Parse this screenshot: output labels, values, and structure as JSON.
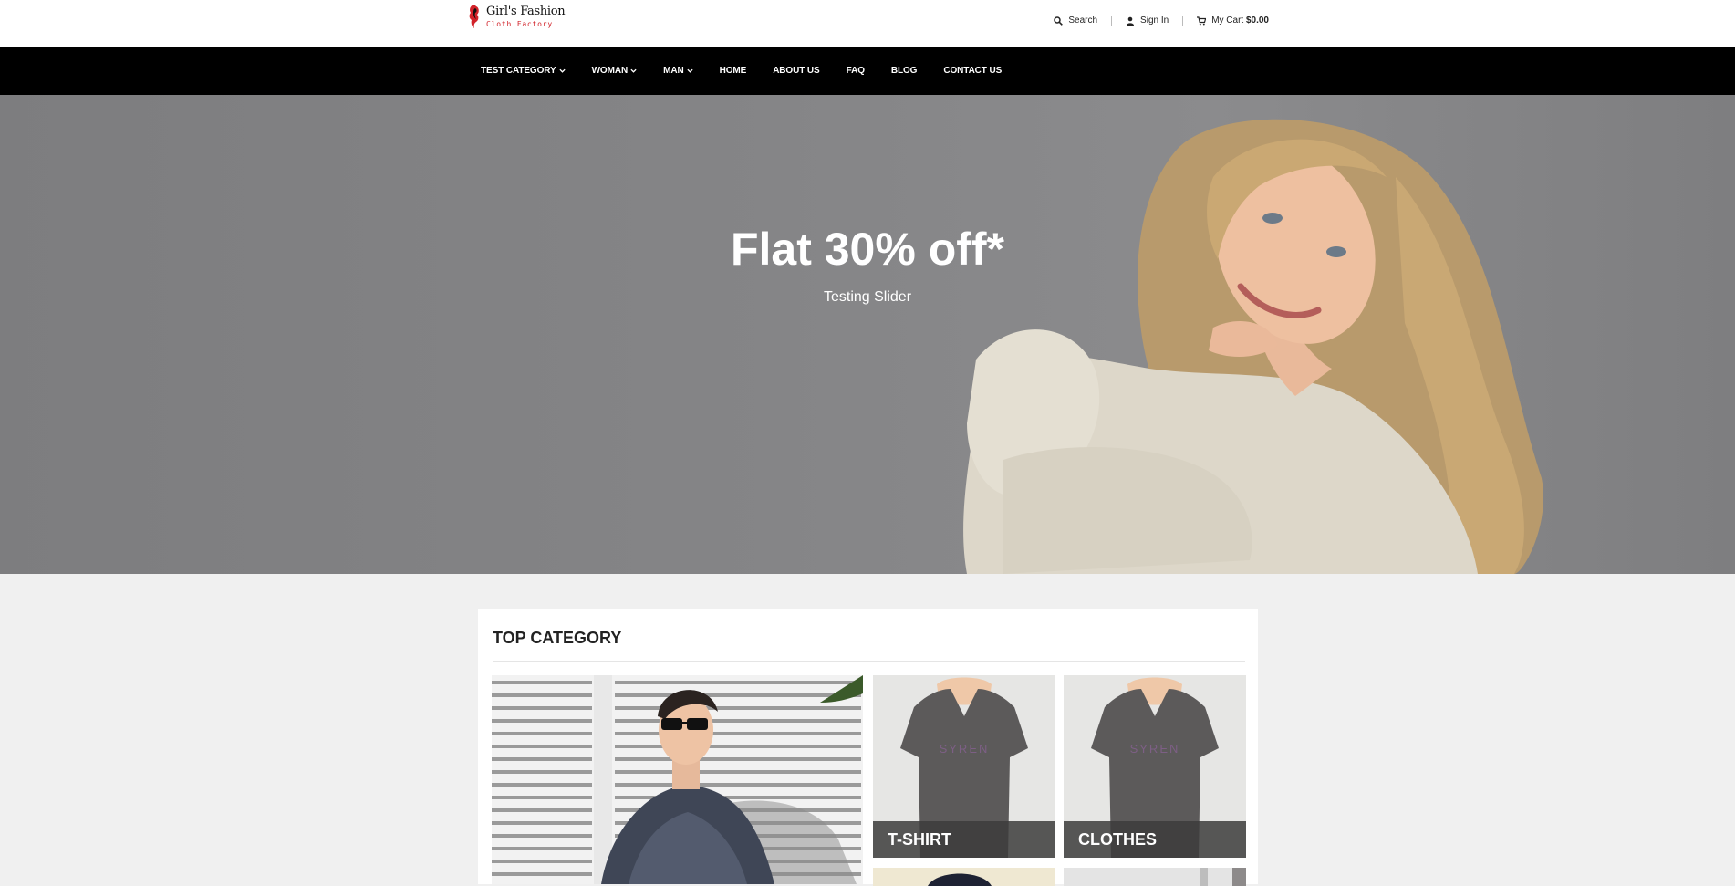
{
  "header": {
    "logo_title": "Girl's Fashion",
    "logo_subtitle": "Cloth Factory",
    "search_label": "Search",
    "signin_label": "Sign In",
    "cart_label": "My Cart",
    "cart_amount": "$0.00"
  },
  "nav": {
    "items": [
      {
        "label": "TEST CATEGORY",
        "dropdown": true
      },
      {
        "label": "WOMAN",
        "dropdown": true
      },
      {
        "label": "MAN",
        "dropdown": true
      },
      {
        "label": "HOME",
        "dropdown": false
      },
      {
        "label": "ABOUT US",
        "dropdown": false
      },
      {
        "label": "FAQ",
        "dropdown": false
      },
      {
        "label": "BLOG",
        "dropdown": false
      },
      {
        "label": "CONTACT US",
        "dropdown": false
      }
    ]
  },
  "hero": {
    "title": "Flat 30% off*",
    "subtitle": "Testing Slider"
  },
  "top_category": {
    "title": "TOP CATEGORY",
    "tiles": [
      {
        "label": "T-SHIRT"
      },
      {
        "label": "CLOTHES"
      }
    ]
  },
  "colors": {
    "nav_bg": "#000000",
    "logo_accent": "#d2232a",
    "page_bg": "#f0f0f0"
  }
}
